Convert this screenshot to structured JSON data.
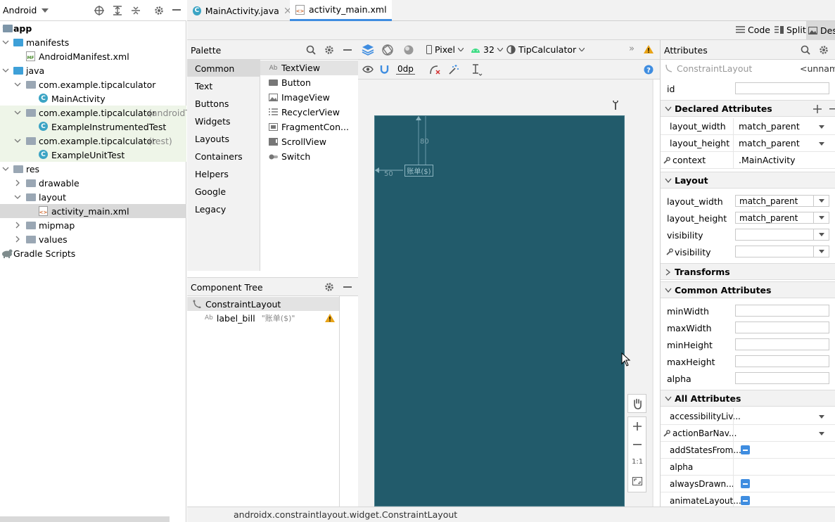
{
  "project_panel": {
    "view_selector": "Android",
    "tree": [
      {
        "label": "app",
        "kind": "module",
        "suffix": ""
      },
      {
        "label": "manifests",
        "kind": "folder",
        "suffix": ""
      },
      {
        "label": "AndroidManifest.xml",
        "kind": "manifest",
        "suffix": ""
      },
      {
        "label": "java",
        "kind": "folder",
        "suffix": ""
      },
      {
        "label": "com.example.tipcalculator",
        "kind": "package",
        "suffix": ""
      },
      {
        "label": "MainActivity",
        "kind": "class",
        "suffix": ""
      },
      {
        "label": "com.example.tipcalculator",
        "kind": "package",
        "suffix": "(androidT"
      },
      {
        "label": "ExampleInstrumentedTest",
        "kind": "class",
        "suffix": ""
      },
      {
        "label": "com.example.tipcalculator",
        "kind": "package",
        "suffix": "(test)"
      },
      {
        "label": "ExampleUnitTest",
        "kind": "class",
        "suffix": ""
      },
      {
        "label": "res",
        "kind": "folder",
        "suffix": ""
      },
      {
        "label": "drawable",
        "kind": "folder",
        "suffix": ""
      },
      {
        "label": "layout",
        "kind": "folder",
        "suffix": ""
      },
      {
        "label": "activity_main.xml",
        "kind": "layout-file",
        "suffix": ""
      },
      {
        "label": "mipmap",
        "kind": "folder",
        "suffix": ""
      },
      {
        "label": "values",
        "kind": "folder",
        "suffix": ""
      },
      {
        "label": "Gradle Scripts",
        "kind": "gradle",
        "suffix": ""
      }
    ]
  },
  "editor_tabs": [
    {
      "label": "MainActivity.java",
      "active": false
    },
    {
      "label": "activity_main.xml",
      "active": true
    }
  ],
  "view_modes": {
    "code": "Code",
    "split": "Split",
    "design": "Des"
  },
  "palette": {
    "title": "Palette",
    "categories": [
      "Common",
      "Text",
      "Buttons",
      "Widgets",
      "Layouts",
      "Containers",
      "Helpers",
      "Google",
      "Legacy"
    ],
    "selected_category": "Common",
    "items": [
      {
        "label": "TextView",
        "icon": "Ab"
      },
      {
        "label": "Button",
        "icon": "button-icon"
      },
      {
        "label": "ImageView",
        "icon": "image-icon"
      },
      {
        "label": "RecyclerView",
        "icon": "list-icon"
      },
      {
        "label": "FragmentCon...",
        "icon": "fragment-icon"
      },
      {
        "label": "ScrollView",
        "icon": "scroll-icon"
      },
      {
        "label": "Switch",
        "icon": "switch-icon"
      }
    ]
  },
  "component_tree": {
    "title": "Component Tree",
    "root": "ConstraintLayout",
    "child": {
      "icon": "Ab",
      "id": "label_bill",
      "text": "\"账单($)\""
    }
  },
  "design_toolbar": {
    "device": "Pixel",
    "api": "32",
    "theme": "TipCalculator",
    "default_margin": "0dp"
  },
  "canvas": {
    "widget_label": "账单($)",
    "margin_top": "80",
    "margin_start": "50",
    "zoom_reset": "1:1"
  },
  "attributes": {
    "title": "Attributes",
    "component": "ConstraintLayout",
    "component_id": "<unname",
    "id_label": "id",
    "declared": {
      "title": "Declared Attributes",
      "rows": [
        {
          "name": "layout_width",
          "value": "match_parent"
        },
        {
          "name": "layout_height",
          "value": "match_parent"
        },
        {
          "name": "context",
          "value": ".MainActivity"
        }
      ]
    },
    "layout": {
      "title": "Layout",
      "rows": [
        {
          "name": "layout_width",
          "value": "match_parent"
        },
        {
          "name": "layout_height",
          "value": "match_parent"
        },
        {
          "name": "visibility",
          "value": ""
        },
        {
          "name": "visibility",
          "value": ""
        }
      ]
    },
    "transforms_title": "Transforms",
    "common": {
      "title": "Common Attributes",
      "rows": [
        "minWidth",
        "maxWidth",
        "minHeight",
        "maxHeight",
        "alpha"
      ]
    },
    "all": {
      "title": "All Attributes",
      "rows": [
        "accessibilityLiv...",
        "actionBarNav...",
        "addStatesFrom...",
        "alpha",
        "alwaysDrawn...",
        "animateLayout..."
      ]
    }
  },
  "status_bar": {
    "path": "androidx.constraintlayout.widget.ConstraintLayout"
  },
  "colors": {
    "accent": "#3f8de0",
    "canvas": "#225b6b",
    "warning": "#e8a317"
  }
}
